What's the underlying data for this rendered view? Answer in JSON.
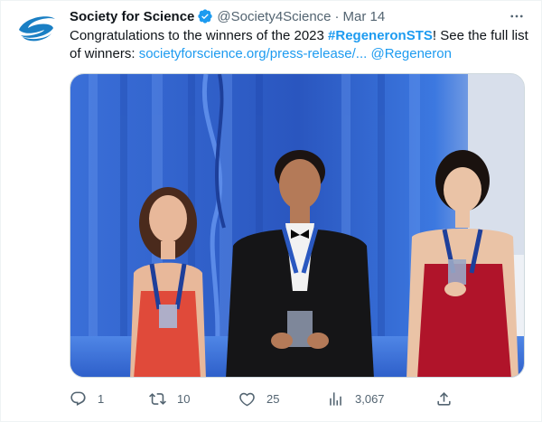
{
  "tweet": {
    "author": {
      "display_name": "Society for Science",
      "handle": "@Society4Science",
      "verified": true
    },
    "separator": "·",
    "timestamp": "Mar 14",
    "text": {
      "part1": "Congratulations to the winners of the 2023 ",
      "hashtag": "#RegeneronSTS",
      "part2": "! See the full list of winners: ",
      "link": "societyforscience.org/press-release/...",
      "space": " ",
      "mention": "@Regeneron"
    },
    "actions": {
      "replies": "1",
      "retweets": "10",
      "likes": "25",
      "views": "3,067"
    }
  },
  "colors": {
    "accent": "#1d9bf0",
    "brand_logo": "#1a7fc4",
    "muted": "#536471",
    "stage_blue": "#2f5fc8"
  },
  "icons": {
    "more": "more-dots-icon",
    "reply": "reply-icon",
    "retweet": "retweet-icon",
    "like": "heart-icon",
    "views": "views-chart-icon",
    "share": "share-icon",
    "verified": "verified-badge-icon"
  }
}
